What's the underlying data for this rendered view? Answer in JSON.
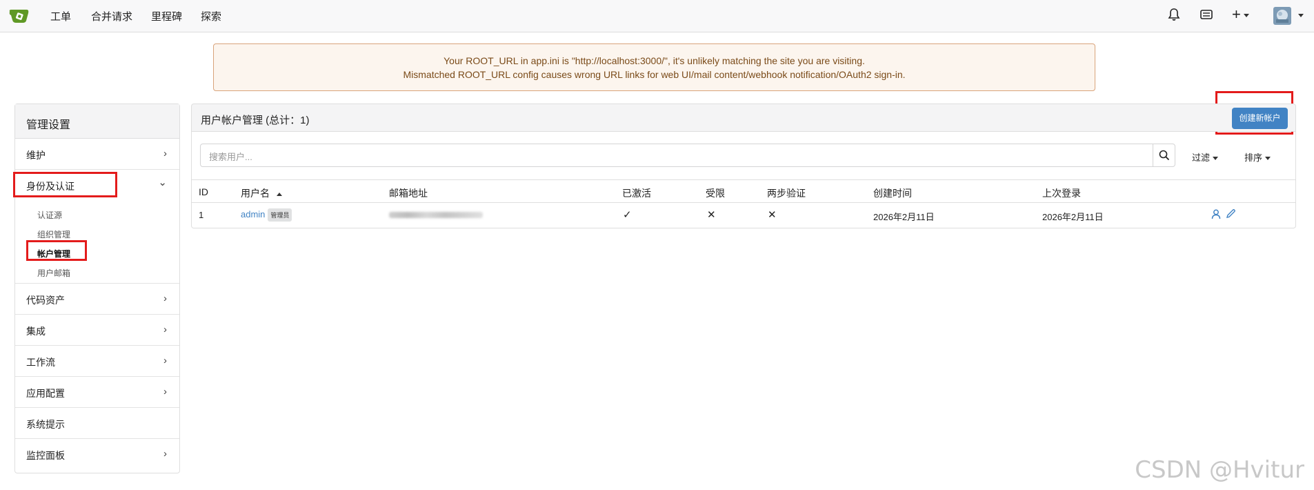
{
  "nav": {
    "items": [
      "工单",
      "合并请求",
      "里程碑",
      "探索"
    ],
    "plus": "+"
  },
  "banner": {
    "line1": "Your ROOT_URL in app.ini is \"http://localhost:3000/\", it's unlikely matching the site you are visiting.",
    "line2": "Mismatched ROOT_URL config causes wrong URL links for web UI/mail content/webhook notification/OAuth2 sign-in."
  },
  "sidebar": {
    "title": "管理设置",
    "items": [
      {
        "label": "维护",
        "chevron": "›"
      },
      {
        "label": "身份及认证",
        "chevron": "⌄",
        "sub": [
          "认证源",
          "组织管理",
          "帐户管理",
          "用户邮箱"
        ]
      },
      {
        "label": "代码资产",
        "chevron": "›"
      },
      {
        "label": "集成",
        "chevron": "›"
      },
      {
        "label": "工作流",
        "chevron": "›"
      },
      {
        "label": "应用配置",
        "chevron": "›"
      },
      {
        "label": "系统提示",
        "chevron": ""
      },
      {
        "label": "监控面板",
        "chevron": "›"
      }
    ]
  },
  "panel": {
    "title": "用户帐户管理 (总计：1)",
    "create_label": "创建新帐户",
    "search_placeholder": "搜索用户...",
    "filter_label": "过滤",
    "sort_label": "排序"
  },
  "table": {
    "columns": [
      "ID",
      "用户名",
      "邮箱地址",
      "已激活",
      "受限",
      "两步验证",
      "创建时间",
      "上次登录"
    ],
    "rows": [
      {
        "id": "1",
        "username": "admin",
        "badge": "管理员",
        "activated": "✓",
        "restricted": "✕",
        "two_factor": "✕",
        "created": "2026年2月11日",
        "last_login": "2026年2月11日"
      }
    ]
  },
  "watermark": "CSDN @Hvitur"
}
